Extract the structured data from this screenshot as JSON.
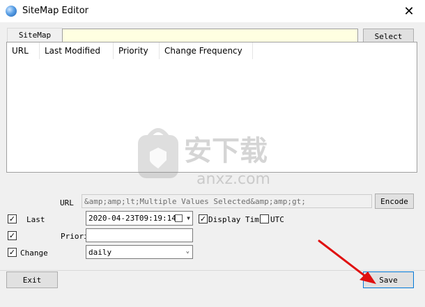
{
  "window": {
    "title": "SiteMap Editor",
    "close_glyph": "✕"
  },
  "sitemap": {
    "label": "SiteMap",
    "path_value": "",
    "select_button": "Select"
  },
  "table": {
    "columns": [
      "URL",
      "Last Modified",
      "Priority",
      "Change Frequency"
    ],
    "rows": []
  },
  "watermark": {
    "brand_text": "安下载",
    "domain_text": "anxz.com"
  },
  "form": {
    "url_label": "URL",
    "url_value": "&amp;amp;lt;Multiple Values Selected&amp;amp;gt;",
    "encode_button": "Encode",
    "last_label": "Last",
    "last_value": "2020-04-23T09:19:14",
    "display_time_label": "Display Tim",
    "utc_label": "UTC",
    "priority_label": "Priori",
    "priority_value": "",
    "change_label": "Change",
    "change_value": "daily"
  },
  "buttons": {
    "exit": "Exit",
    "save": "Save"
  },
  "colors": {
    "input_highlight": "#ffffe1",
    "dialog_bg": "#f0f0f0",
    "arrow": "#e01010"
  }
}
